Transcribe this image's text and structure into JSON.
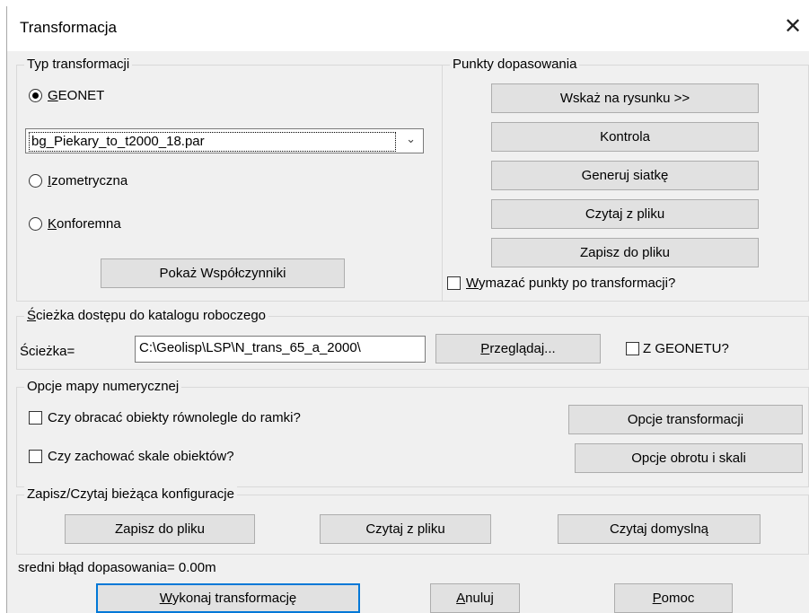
{
  "window": {
    "title": "Transformacja",
    "close_glyph": "✕"
  },
  "typ": {
    "legend": "Typ transformacji",
    "geonet_rest": "EONET",
    "geonet_u": "G",
    "dropdown_value": "bg_Piekary_to_t2000_18.par",
    "izometryczna_u": "I",
    "izometryczna_rest": "zometryczna",
    "konforemna_u": "K",
    "konforemna_rest": "onforemna",
    "pokaz_button": "Pokaż Współczynniki",
    "selected": "GEONET"
  },
  "punkty": {
    "legend": "Punkty dopasowania",
    "buttons": [
      "Wskaż na rysunku >>",
      "Kontrola",
      "Generuj siatkę",
      "Czytaj z pliku",
      "Zapisz do pliku"
    ],
    "wymazac_u": "W",
    "wymazac_rest": "ymazać punkty po transformacji?",
    "wymazac_checked": false
  },
  "sciezka": {
    "legend_u": "Ś",
    "legend_rest": "cieżka dostępu do katalogu roboczego",
    "label": "Ścieżka=",
    "value": "C:\\Geolisp\\LSP\\N_trans_65_a_2000\\",
    "przegladaj_u": "P",
    "przegladaj_rest": "rzeglądaj...",
    "zgeonetu_label": "Z GEONETU?",
    "zgeonetu_checked": false
  },
  "opcje": {
    "legend": "Opcje mapy numerycznej",
    "obracac_label": "Czy obracać obiekty równolegle do ramki?",
    "zachowac_label": "Czy zachować skale obiektów?",
    "opcje_transformacji": "Opcje transformacji",
    "opcje_obrotu": "Opcje obrotu i skali"
  },
  "konfig": {
    "legend": "Zapisz/Czytaj bieżąca konfiguracje",
    "zapisz": "Zapisz do pliku",
    "czytaj": "Czytaj z pliku",
    "domyslna": "Czytaj domyslną"
  },
  "status": {
    "blad": "sredni błąd dopasowania= 0.00m"
  },
  "bottom": {
    "wykonaj_u": "W",
    "wykonaj_rest": "ykonaj transformację",
    "anuluj_u": "A",
    "anuluj_rest": "nuluj",
    "pomoc_u": "P",
    "pomoc_rest": "omoc"
  }
}
